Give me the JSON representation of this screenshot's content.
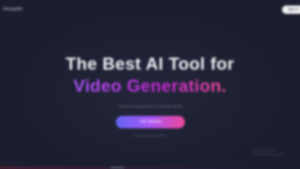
{
  "header": {
    "logo_text": "Vexuplet",
    "top_button_label": "Sign In"
  },
  "hero": {
    "line1": "The Best AI Tool for",
    "line2": "Video Generation."
  },
  "subtitle": "Create stunning videos in seconds with AI",
  "cta": {
    "label": "Get Started"
  },
  "note": "No credit card required",
  "corner_note": {
    "line1": "Activate Windows",
    "line2": "Go to Settings to activate."
  },
  "colors": {
    "background": "#1b1e2e",
    "heading": "#eef0f5",
    "accent_gradient": [
      "#a855f7",
      "#c026d3",
      "#ec4899"
    ],
    "button_gradient": [
      "#6366f1",
      "#a855f7",
      "#ec4899"
    ]
  }
}
